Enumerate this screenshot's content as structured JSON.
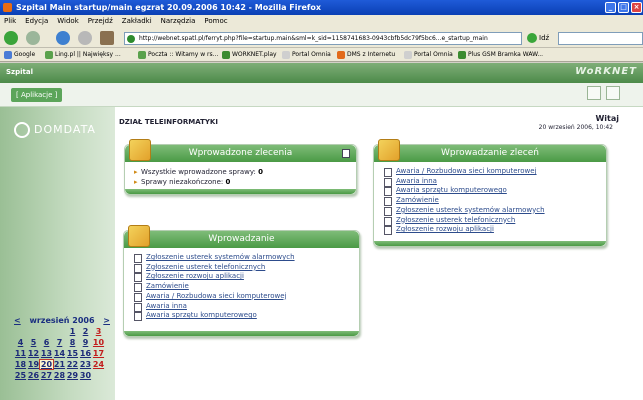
{
  "browser": {
    "window_title": "Szpital   Main   startup/main   egzrat   20.09.2006 10:42 - Mozilla Firefox",
    "menu": [
      "Plik",
      "Edycja",
      "Widok",
      "Przejdź",
      "Zakładki",
      "Narzędzia",
      "Pomoc"
    ],
    "url": "http://webnet.spatl.pl/ferryt.php?file=startup.main&sml=k_sid=1158741683-0943cbfb5dc79f5bc6...e_startup_main",
    "go_label": "Idź",
    "bookmarks": [
      "Google",
      "Ling.pl || Najwięksy ...",
      "Poczta :: Witamy w rs...",
      "WORKNET.play",
      "Portal Omnia",
      "DMS z Internetu",
      "Portal Omnia",
      "Plus GSM Bramka WAW..."
    ]
  },
  "app": {
    "title": "Szpital",
    "brand": "WoRKNET",
    "tab_label": "[ Aplikacje ]",
    "logo_text": "DOMDATA",
    "department": "DZIAŁ TELEINFORMATYKI",
    "greeting": "Witaj",
    "datetime": "20 wrzesień 2006, 10:42"
  },
  "calendar": {
    "prev": "<",
    "next": ">",
    "month": "wrzesień 2006",
    "today": "20",
    "weeks": [
      [
        "",
        "",
        "",
        "",
        "1",
        "2",
        "3"
      ],
      [
        "4",
        "5",
        "6",
        "7",
        "8",
        "9",
        "10"
      ],
      [
        "11",
        "12",
        "13",
        "14",
        "15",
        "16",
        "17"
      ],
      [
        "18",
        "19",
        "20",
        "21",
        "22",
        "23",
        "24"
      ],
      [
        "25",
        "26",
        "27",
        "28",
        "29",
        "30",
        ""
      ]
    ]
  },
  "panels": {
    "stats": {
      "title": "Wprowadzone zlecenia",
      "all_label": "Wszystkie wprowadzone sprawy:",
      "all_value": "0",
      "open_label": "Sprawy niezakończone:",
      "open_value": "0"
    },
    "list": {
      "title": "Wprowadzanie",
      "items": [
        "Zgłoszenie usterek systemów alarmowych",
        "Zgłoszenie usterek telefonicznych",
        "Zgłoszenie rozwoju aplikacji",
        "Zamówienie",
        "Awaria / Rozbudowa sieci komputerowej",
        "Awaria inna",
        "Awaria sprzętu komputerowego"
      ]
    },
    "form": {
      "title": "Wprowadzanie zleceń",
      "items": [
        "Awaria / Rozbudowa sieci komputerowej",
        "Awaria inna",
        "Awaria sprzętu komputerowego",
        "Zamówienie",
        "Zgłoszenie usterek systemów alarmowych",
        "Zgłoszenie usterek telefonicznych",
        "Zgłoszenie rozwoju aplikacji"
      ]
    }
  },
  "colors": {
    "header_green": "#4c8a49",
    "panel_green": "#4a9a45",
    "link_blue": "#2d4c8c",
    "sunday_red": "#c21c1c"
  }
}
